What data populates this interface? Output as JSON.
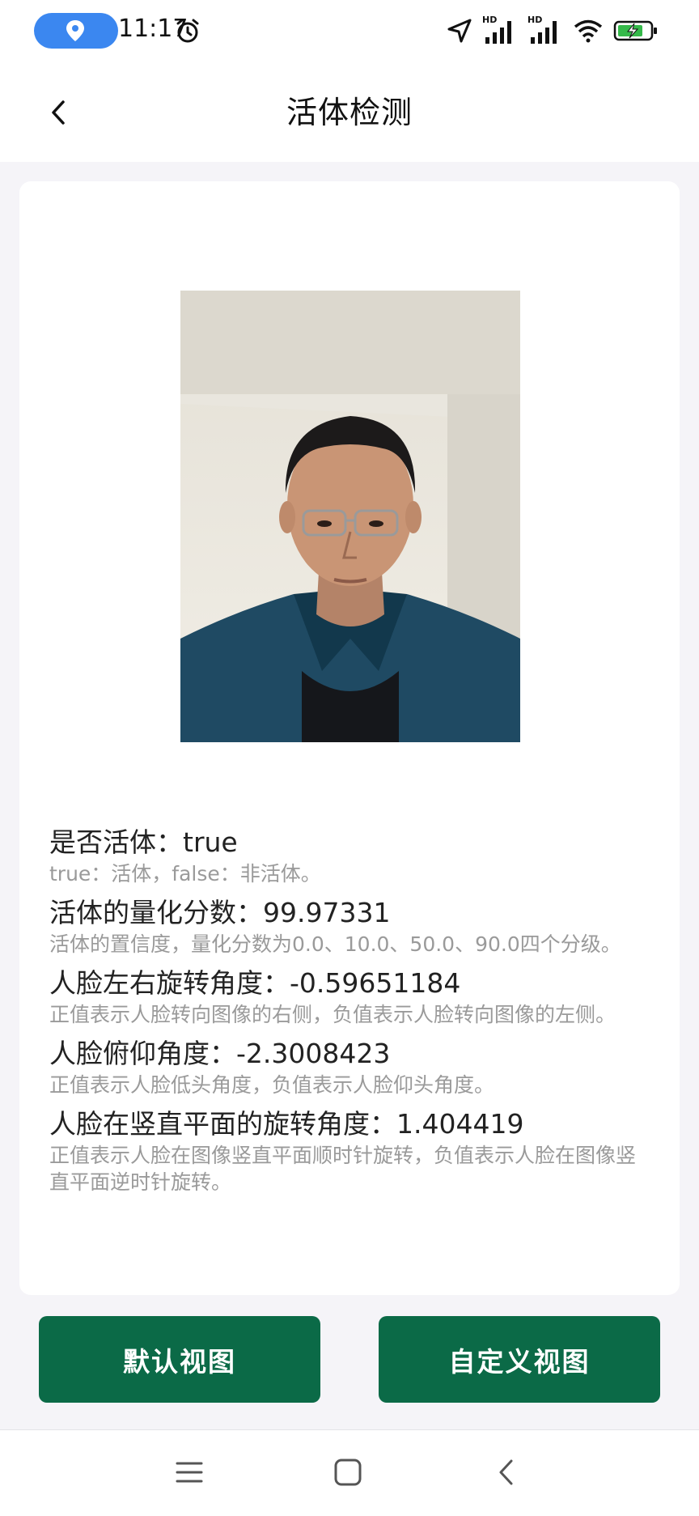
{
  "status_bar": {
    "time": "11:17",
    "icons": [
      "location-pill-icon",
      "alarm-icon",
      "navigation-arrow-icon",
      "hd-signal-icon",
      "hd-signal-icon",
      "wifi-icon",
      "battery-charging-icon"
    ],
    "hd_label": "HD"
  },
  "header": {
    "title": "活体检测",
    "back_icon": "back-chevron-icon"
  },
  "photo": {
    "description_icon": "face-photo"
  },
  "results": [
    {
      "label": "是否活体：true",
      "desc": "true：活体，false：非活体。"
    },
    {
      "label": "活体的量化分数：99.97331",
      "desc": "活体的置信度，量化分数为0.0、10.0、50.0、90.0四个分级。"
    },
    {
      "label": "人脸左右旋转角度：-0.59651184",
      "desc": "正值表示人脸转向图像的右侧，负值表示人脸转向图像的左侧。"
    },
    {
      "label": "人脸俯仰角度：-2.3008423",
      "desc": "正值表示人脸低头角度，负值表示人脸仰头角度。"
    },
    {
      "label": "人脸在竖直平面的旋转角度：1.404419",
      "desc": "正值表示人脸在图像竖直平面顺时针旋转，负值表示人脸在图像竖直平面逆时针旋转。"
    }
  ],
  "buttons": {
    "default_view": "默认视图",
    "custom_view": "自定义视图"
  },
  "colors": {
    "accent": "#0b6a47",
    "location_pill": "#3b87f0",
    "battery": "#35b94a"
  },
  "navbar": {
    "icons": [
      "menu-icon",
      "home-square-icon",
      "back-icon"
    ]
  }
}
